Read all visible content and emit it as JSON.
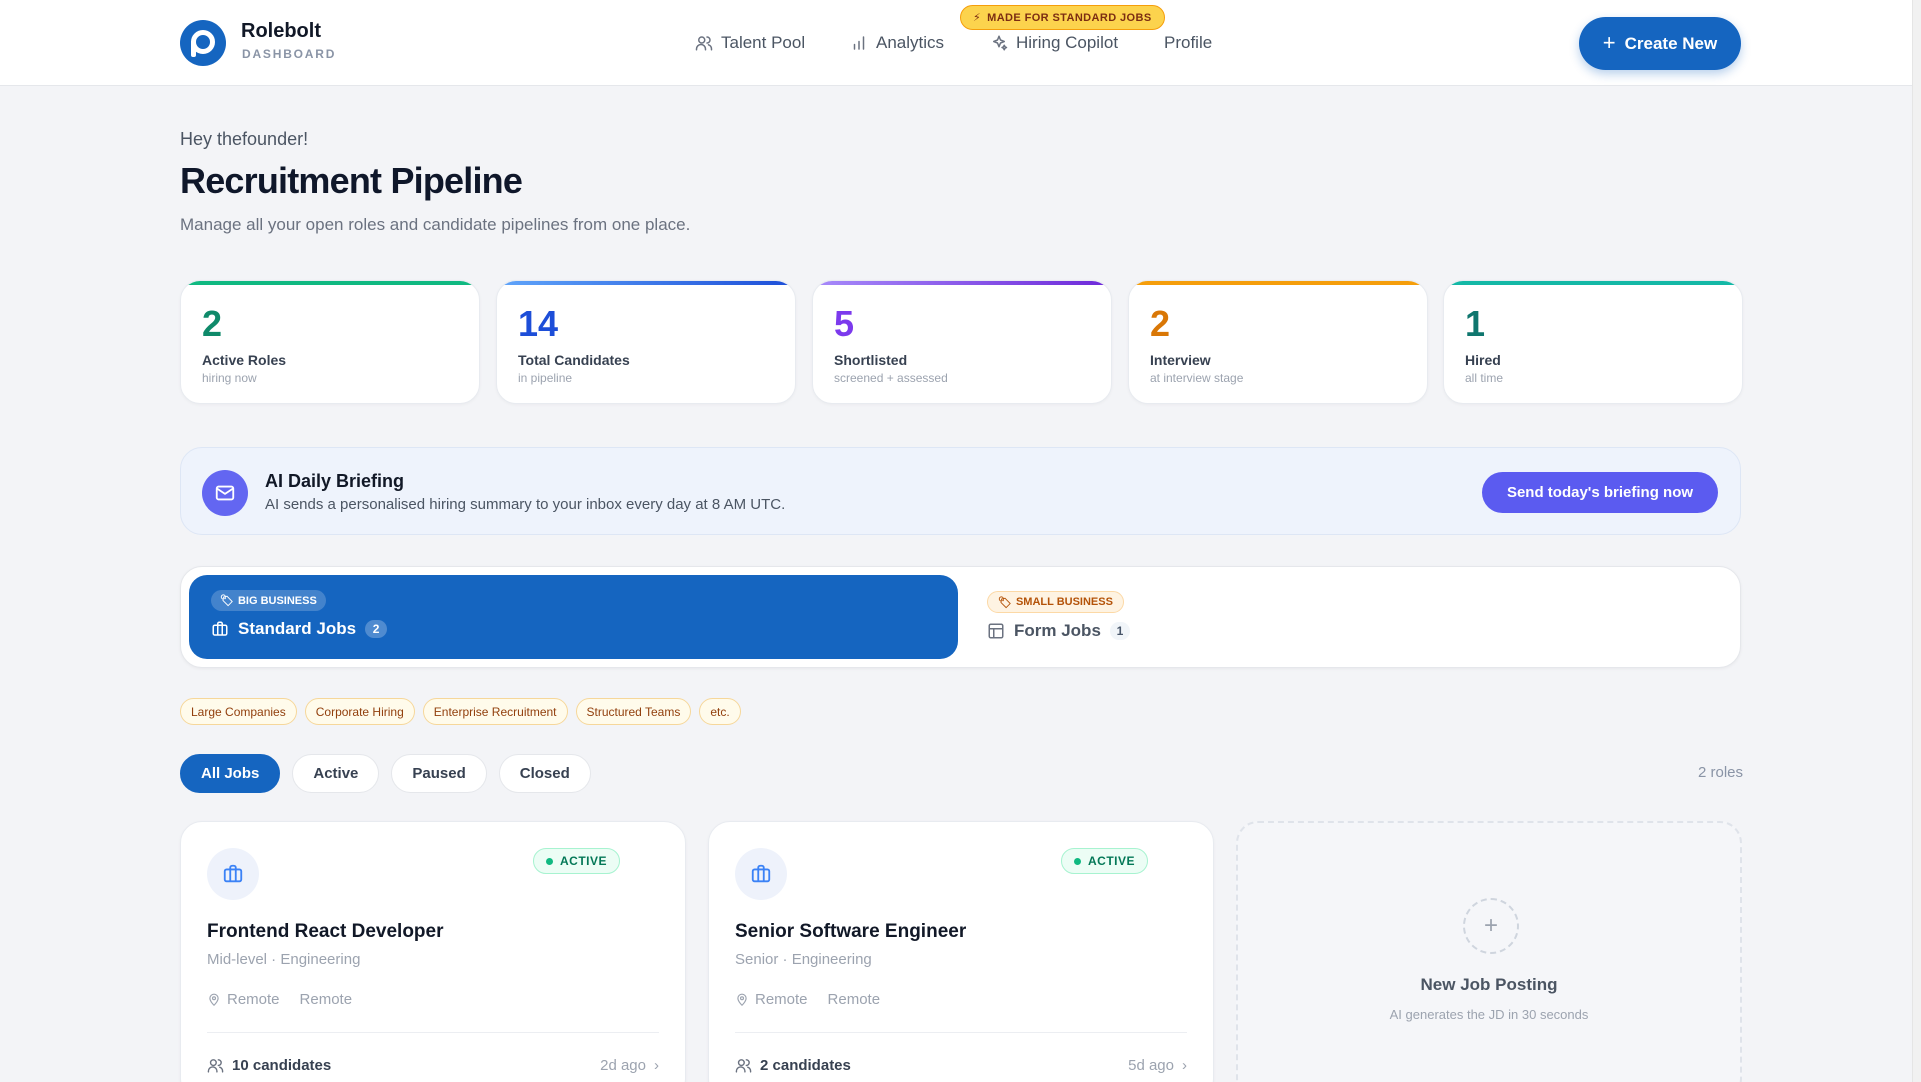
{
  "brand": {
    "name": "Rolebolt",
    "subtitle": "DASHBOARD",
    "color": "#1565c0"
  },
  "nav": {
    "items": [
      {
        "label": "Talent Pool",
        "icon": "users-icon"
      },
      {
        "label": "Analytics",
        "icon": "bar-chart-icon"
      },
      {
        "label": "Hiring Copilot",
        "icon": "sparkles-icon"
      },
      {
        "label": "Profile",
        "icon": ""
      }
    ],
    "badge": "MADE FOR STANDARD JOBS",
    "create_label": "Create New"
  },
  "header": {
    "greeting": "Hey thefounder!",
    "title": "Recruitment Pipeline",
    "subtitle": "Manage all your open roles and candidate pipelines from one place."
  },
  "stats": [
    {
      "value": "2",
      "label": "Active Roles",
      "sub": "hiring now",
      "color": "#0f8a6a",
      "bar": "#10b981"
    },
    {
      "value": "14",
      "label": "Total Candidates",
      "sub": "in pipeline",
      "color": "#1d4ed8",
      "bar": "#2563eb"
    },
    {
      "value": "5",
      "label": "Shortlisted",
      "sub": "screened + assessed",
      "color": "#7c3aed",
      "bar": "#8b5cf6"
    },
    {
      "value": "2",
      "label": "Interview",
      "sub": "at interview stage",
      "color": "#d97706",
      "bar": "#f59e0b"
    },
    {
      "value": "1",
      "label": "Hired",
      "sub": "all time",
      "color": "#0f766e",
      "bar": "#14b8a6"
    }
  ],
  "briefing": {
    "title": "AI Daily Briefing",
    "sub": "AI sends a personalised hiring summary to your inbox every day at 8 AM UTC.",
    "button": "Send today's briefing now"
  },
  "job_types": {
    "standard": {
      "badge": "BIG BUSINESS",
      "label": "Standard Jobs",
      "count": "2"
    },
    "form": {
      "badge": "SMALL BUSINESS",
      "label": "Form Jobs",
      "count": "1"
    }
  },
  "tags": [
    "Large Companies",
    "Corporate Hiring",
    "Enterprise Recruitment",
    "Structured Teams",
    "etc."
  ],
  "filters": [
    "All Jobs",
    "Active",
    "Paused",
    "Closed"
  ],
  "roles_count": "2 roles",
  "jobs": [
    {
      "title": "Frontend React Developer",
      "meta": "Mid-level · Engineering",
      "loc1": "Remote",
      "loc2": "Remote",
      "status": "ACTIVE",
      "candidates": "10 candidates",
      "ago": "2d ago"
    },
    {
      "title": "Senior Software Engineer",
      "meta": "Senior · Engineering",
      "loc1": "Remote",
      "loc2": "Remote",
      "status": "ACTIVE",
      "candidates": "2 candidates",
      "ago": "5d ago"
    }
  ],
  "new_job": {
    "title": "New Job Posting",
    "sub": "AI generates the JD in 30 seconds"
  }
}
